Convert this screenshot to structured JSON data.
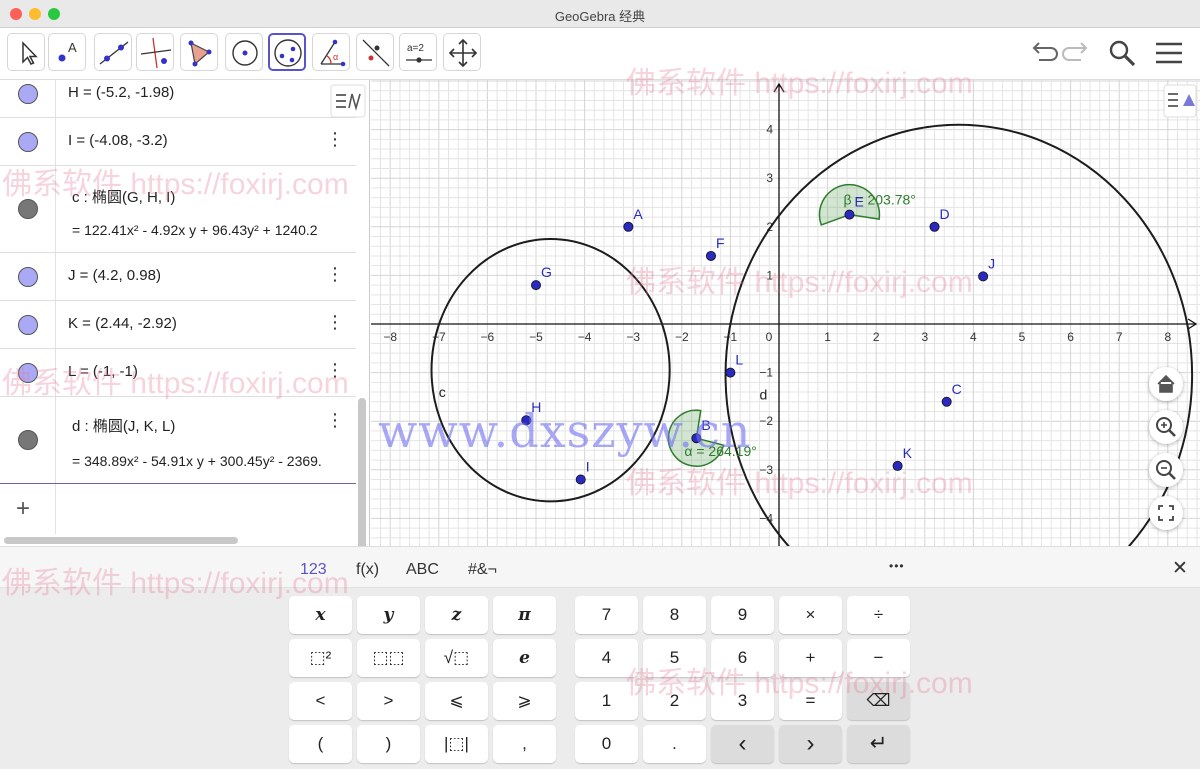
{
  "window": {
    "title": "GeoGebra 经典"
  },
  "algebra": {
    "rows": [
      {
        "text": "H = (-5.2, -1.98)"
      },
      {
        "text": "I = (-4.08, -3.2)"
      },
      {
        "line1": "c : 椭圆(G, H, I)",
        "line2": "=  122.41x² - 4.92x y + 96.43y² + 1240.2"
      },
      {
        "text": "J = (4.2, 0.98)"
      },
      {
        "text": "K = (2.44, -2.92)"
      },
      {
        "text": "L = (-1, -1)"
      },
      {
        "line1": "d : 椭圆(J, K, L)",
        "line2": "=  348.89x² - 54.91x y + 300.45y² - 2369."
      }
    ],
    "add_label": "+"
  },
  "graph": {
    "x_ticks": [
      "−8",
      "−7",
      "−6",
      "−5",
      "−4",
      "−3",
      "−2",
      "−1",
      "0",
      "1",
      "2",
      "3",
      "4",
      "5",
      "6",
      "7",
      "8"
    ],
    "y_ticks": [
      "4",
      "3",
      "2",
      "1",
      "−1",
      "−2",
      "−3",
      "−4"
    ],
    "points": [
      {
        "name": "A",
        "x": -3.1,
        "y": 2.0
      },
      {
        "name": "B",
        "x": -1.7,
        "y": -2.35
      },
      {
        "name": "C",
        "x": 3.45,
        "y": -1.6
      },
      {
        "name": "D",
        "x": 3.2,
        "y": 2.0
      },
      {
        "name": "E",
        "x": 1.45,
        "y": 2.25
      },
      {
        "name": "F",
        "x": -1.4,
        "y": 1.4
      },
      {
        "name": "G",
        "x": -5.0,
        "y": 0.8
      },
      {
        "name": "H",
        "x": -5.2,
        "y": -1.98
      },
      {
        "name": "I",
        "x": -4.08,
        "y": -3.2
      },
      {
        "name": "J",
        "x": 4.2,
        "y": 0.98
      },
      {
        "name": "K",
        "x": 2.44,
        "y": -2.92
      },
      {
        "name": "L",
        "x": -1.0,
        "y": -1.0
      }
    ],
    "conics": [
      {
        "name": "c",
        "cx": -4.7,
        "cy": -0.95,
        "rx": 2.45,
        "ry": 2.7
      },
      {
        "name": "d",
        "cx": 3.7,
        "cy": -1.05,
        "rx": 4.8,
        "ry": 5.15
      }
    ],
    "angles": [
      {
        "label": "β = 203.78°",
        "at": "E"
      },
      {
        "label": "α = 264.19°",
        "at": "B"
      }
    ],
    "colors": {
      "point": "#2a2abf",
      "curve": "#1c1c1c",
      "angle": "#2d7d2d",
      "grid": "#e4e4e4",
      "axis": "#111111"
    }
  },
  "keyboard": {
    "tabs": [
      "123",
      "f(x)",
      "ABC",
      "#&¬"
    ],
    "more": "•••",
    "close": "✕",
    "keys": {
      "x": "x",
      "y": "y",
      "z": "z",
      "pi": "π",
      "sq": "⬚²",
      "pow": "⬚⬚",
      "sqrt": "√⬚",
      "e": "e",
      "lt": "<",
      "gt": ">",
      "le": "⩽",
      "ge": "⩾",
      "lp": "(",
      "rp": ")",
      "abs": "|⬚|",
      "comma": ",",
      "n7": "7",
      "n8": "8",
      "n9": "9",
      "mul": "×",
      "div": "÷",
      "n4": "4",
      "n5": "5",
      "n6": "6",
      "plus": "+",
      "minus": "−",
      "n1": "1",
      "n2": "2",
      "n3": "3",
      "eq": "=",
      "bksp": "⌫",
      "n0": "0",
      "dot": ".",
      "left": "‹",
      "right": "›",
      "enter": "↵"
    }
  },
  "watermarks": {
    "small": "佛系软件 https://foxirj.com",
    "big": "www.dxszyw.cn"
  }
}
